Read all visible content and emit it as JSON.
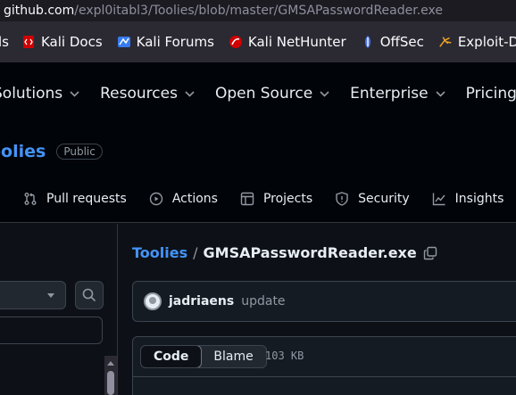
{
  "browser": {
    "url_host": "github.com",
    "url_path": "/expl0itabl3/Toolies/blob/master/GMSAPasswordReader.exe"
  },
  "bookmarks": [
    {
      "label": "ls",
      "icon": "bookmark-fragment"
    },
    {
      "label": "Kali Docs",
      "icon": "kali-docs-icon",
      "color": "#d00000"
    },
    {
      "label": "Kali Forums",
      "icon": "kali-forums-icon",
      "color": "#367bf0"
    },
    {
      "label": "Kali NetHunter",
      "icon": "kali-nethunter-icon",
      "color": "#d00000"
    },
    {
      "label": "OffSec",
      "icon": "offsec-icon",
      "color": "#4c73e6"
    },
    {
      "label": "Exploit-DB",
      "icon": "exploit-db-icon",
      "color": "#f5a623"
    }
  ],
  "header_nav": [
    {
      "label": "Solutions"
    },
    {
      "label": "Resources"
    },
    {
      "label": "Open Source"
    },
    {
      "label": "Enterprise"
    },
    {
      "label": "Pricing"
    }
  ],
  "repo": {
    "name": "oolies",
    "visibility": "Public"
  },
  "repo_tabs": [
    {
      "label": "Pull requests",
      "icon": "pull-request-icon"
    },
    {
      "label": "Actions",
      "icon": "actions-play-icon"
    },
    {
      "label": "Projects",
      "icon": "projects-table-icon"
    },
    {
      "label": "Security",
      "icon": "shield-icon"
    },
    {
      "label": "Insights",
      "icon": "graph-icon"
    }
  ],
  "breadcrumb": {
    "repo": "Toolies",
    "separator": "/",
    "file": "GMSAPasswordReader.exe"
  },
  "commit": {
    "author": "jadriaens",
    "message": "update"
  },
  "file_view": {
    "tabs": [
      {
        "label": "Code"
      },
      {
        "label": "Blame"
      }
    ],
    "active_tab": "Code",
    "size": "103 KB"
  },
  "colors": {
    "accent_link": "#4493f8",
    "background": "#0d1117",
    "header": "#010409"
  }
}
